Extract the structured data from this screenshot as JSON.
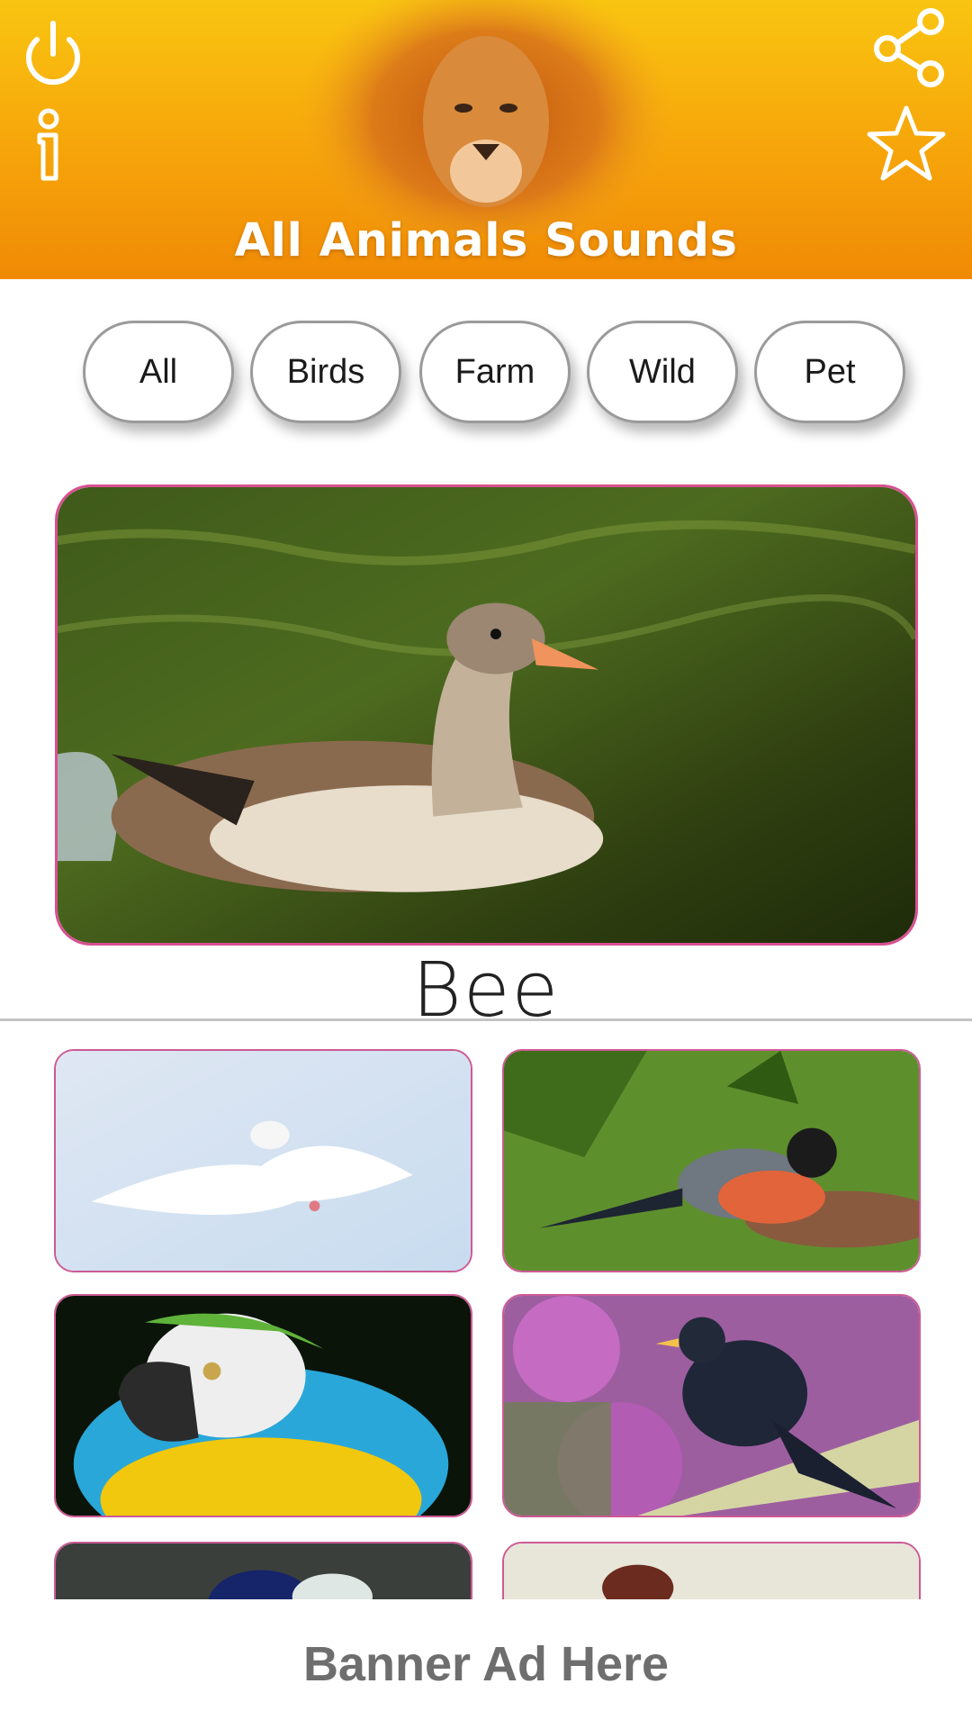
{
  "header": {
    "title": "All Animals Sounds",
    "background": "#f6a40a",
    "icons": {
      "power": "power-icon",
      "info": "info-icon",
      "share": "share-icon",
      "star": "star-icon"
    }
  },
  "categories": [
    {
      "label": "All"
    },
    {
      "label": "Birds"
    },
    {
      "label": "Farm"
    },
    {
      "label": "Wild"
    },
    {
      "label": "Pet"
    }
  ],
  "featured": {
    "name": "Bee",
    "image": "goose-photo",
    "border_color": "#d94f91"
  },
  "grid": [
    {
      "image": "dove-photo"
    },
    {
      "image": "bullfinch-photo"
    },
    {
      "image": "macaw-photo"
    },
    {
      "image": "blackbird-photo"
    },
    {
      "image": "bird-photo"
    },
    {
      "image": "bird-photo"
    }
  ],
  "banner": {
    "text": "Banner Ad Here"
  }
}
